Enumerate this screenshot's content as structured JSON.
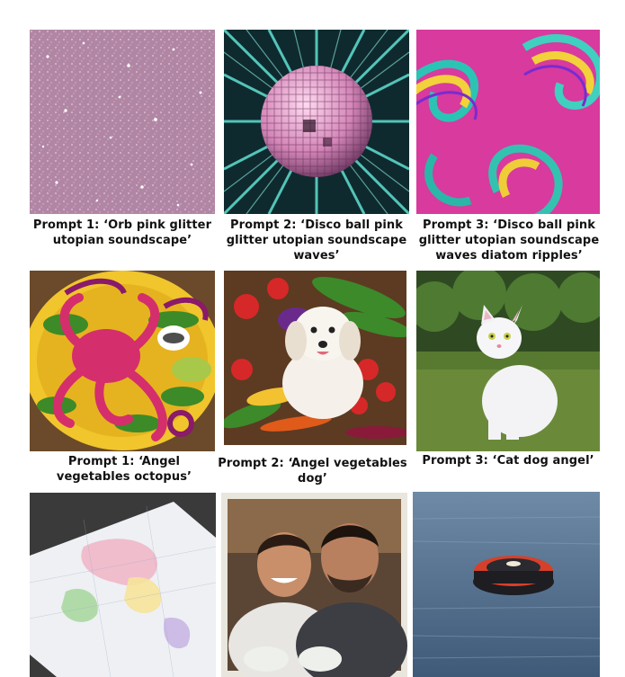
{
  "captions": {
    "r1c1": "Prompt 1: ‘Orb pink glitter utopian soundscape’",
    "r1c2": "Prompt 2: ‘Disco ball pink glitter utopian soundscape waves’",
    "r1c3": "Prompt 3: ‘Disco ball pink glitter utopian soundscape waves diatom ripples’",
    "r2c1": "Prompt 1: ‘Angel vegetables octopus’",
    "r2c2": "Prompt 2: ‘Angel vegetables dog’",
    "r2c3": "Prompt 3: ‘Cat dog angel’"
  },
  "images": {
    "r1c1": "pink-glitter-texture",
    "r1c2": "disco-ball-teal-burst",
    "r1c3": "psychedelic-swirls",
    "r2c1": "octopus-on-vegetable-plate",
    "r2c2": "puppy-among-vegetables",
    "r2c3": "white-cat-on-lawn",
    "r3c1": "world-map-on-table",
    "r3c2": "two-men-selfie",
    "r3c3": "buoy-floating-in-water"
  }
}
